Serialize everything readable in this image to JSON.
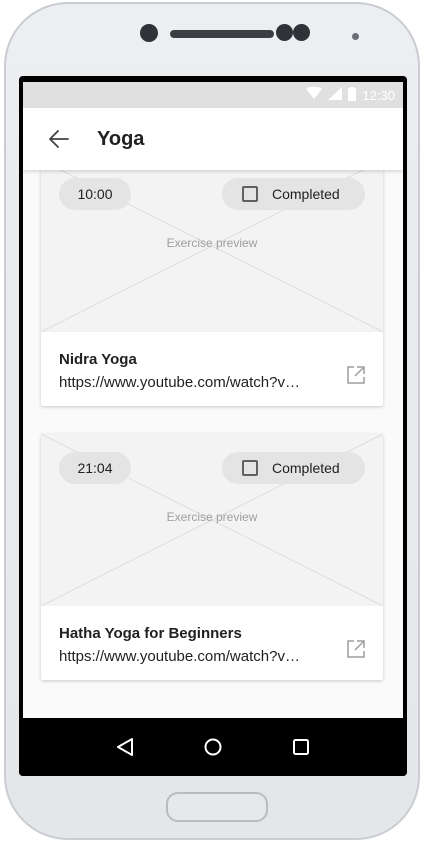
{
  "status_bar": {
    "time": "12:30",
    "icons": [
      "wifi-icon",
      "signal-icon",
      "battery-icon"
    ]
  },
  "app_bar": {
    "back_icon": "arrow-left-icon",
    "title": "Yoga"
  },
  "exercises": [
    {
      "duration": "10:00",
      "completed_label": "Completed",
      "completed": false,
      "preview_label": "Exercise preview",
      "title": "Nidra Yoga",
      "link": "https://www.youtube.com/watch?v…",
      "open_icon": "open-in-new-icon"
    },
    {
      "duration": "21:04",
      "completed_label": "Completed",
      "completed": false,
      "preview_label": "Exercise preview",
      "title": "Hatha Yoga for Beginners",
      "link": "https://www.youtube.com/watch?v…",
      "open_icon": "open-in-new-icon"
    }
  ],
  "nav_bar": {
    "buttons": [
      "back-triangle-icon",
      "home-circle-icon",
      "recents-square-icon"
    ]
  },
  "colors": {
    "status_bar": "#e0e0e0",
    "app_bar": "#ffffff",
    "chip": "#e4e4e4",
    "preview_bg": "#f3f3f3",
    "nav_bar": "#000000"
  }
}
